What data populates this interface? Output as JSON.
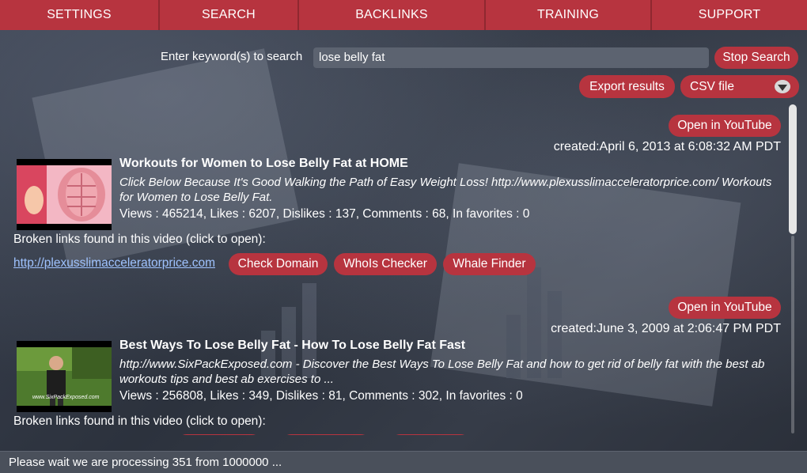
{
  "nav": {
    "tabs": [
      "SETTINGS",
      "SEARCH",
      "BACKLINKS",
      "TRAINING",
      "SUPPORT"
    ]
  },
  "search": {
    "label": "Enter keyword(s) to search",
    "value": "lose belly fat",
    "stop_label": "Stop Search"
  },
  "export": {
    "label": "Export results",
    "format_selected": "CSV file"
  },
  "results": [
    {
      "open_label": "Open in YouTube",
      "created": "created:April 6, 2013 at 6:08:32 AM PDT",
      "title": "Workouts for Women to Lose Belly Fat at HOME",
      "description": "Click Below Because It's Good Walking the Path of Easy Weight Loss! http://www.plexusslimacceleratorprice.com/ Workouts for Women to Lose Belly Fat.",
      "stats": "Views : 465214,  Likes : 6207,  Dislikes : 137,  Comments : 68,  In favorites : 0",
      "broken_label": "Broken links found in this video (click to open):",
      "broken_link": "http://plexusslimacceleratorprice.com",
      "actions": [
        "Check Domain",
        "WhoIs Checker",
        "Whale Finder"
      ]
    },
    {
      "open_label": "Open in YouTube",
      "created": "created:June 3, 2009 at 2:06:47 PM PDT",
      "title": "Best Ways To Lose Belly Fat - How To Lose Belly Fat Fast",
      "description": "http://www.SixPackExposed.com - Discover the Best Ways To Lose Belly Fat and how to get rid of belly fat with the best ab workouts tips and best ab exercises to ...",
      "stats": "Views : 256808,  Likes : 349,  Dislikes : 81,  Comments : 302,  In favorites : 0",
      "broken_label": "Broken links found in this video (click to open):",
      "thumb_caption": "www.SixPackExposed.com"
    }
  ],
  "status": "Please wait we are processing 351 from 1000000 ...",
  "colors": {
    "accent": "#b7343f",
    "link": "#9fc3ff",
    "input_bg": "#5c6370"
  }
}
